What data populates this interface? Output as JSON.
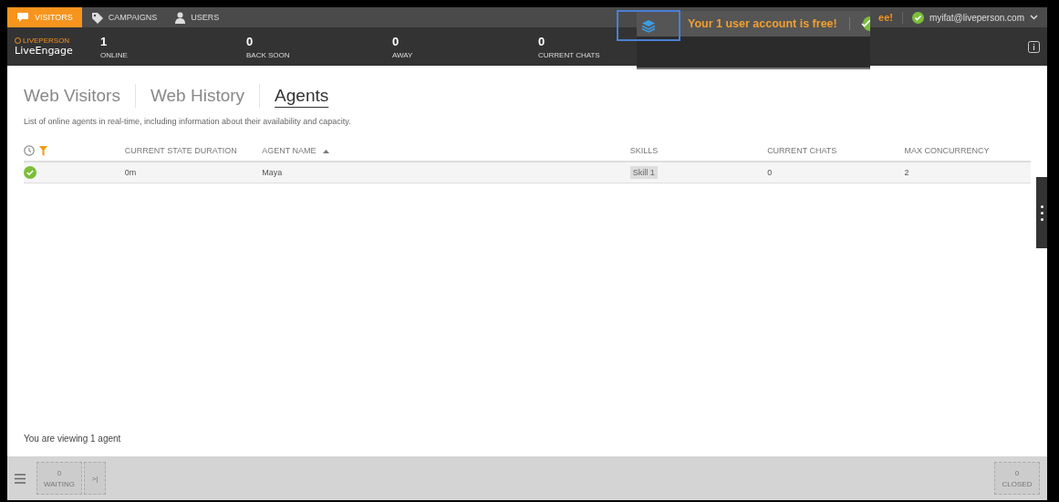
{
  "nav_tabs": [
    {
      "label": "VISITORS",
      "kind": "chat",
      "selected": true
    },
    {
      "label": "CAMPAIGNS",
      "kind": "tag",
      "selected": false
    },
    {
      "label": "USERS",
      "kind": "user",
      "selected": false
    }
  ],
  "brand": {
    "small": "LIVEPERSON",
    "name": "LiveEngage"
  },
  "stats": [
    {
      "value": "1",
      "label": "ONLINE"
    },
    {
      "value": "0",
      "label": "BACK SOON"
    },
    {
      "value": "0",
      "label": "AWAY"
    },
    {
      "value": "0",
      "label": "CURRENT CHATS"
    }
  ],
  "notice_tail": "ee!",
  "user": {
    "email": "myifat@liveperson.com",
    "online": true
  },
  "popup": {
    "text": "Your 1 user account is free!"
  },
  "view_tabs": [
    {
      "label": "Web Visitors",
      "selected": false
    },
    {
      "label": "Web History",
      "selected": false
    },
    {
      "label": "Agents",
      "selected": true
    }
  ],
  "description": "List of online agents in real-time, including information about their availability and capacity.",
  "table": {
    "columns": [
      {
        "label": "CURRENT STATE DURATION",
        "sorted": false
      },
      {
        "label": "AGENT NAME",
        "sorted": true
      },
      {
        "label": "SKILLS",
        "sorted": false
      },
      {
        "label": "CURRENT CHATS",
        "sorted": false
      },
      {
        "label": "MAX CONCURRENCY",
        "sorted": false
      }
    ],
    "rows": [
      {
        "available": true,
        "duration": "0m",
        "name": "Maya",
        "skill": "Skill 1",
        "chats": "0",
        "max": "2"
      }
    ]
  },
  "status": "You are viewing 1 agent",
  "footer": {
    "waiting": {
      "value": "0",
      "label": "WAITING"
    },
    "next": ">|",
    "closed": {
      "value": "0",
      "label": "CLOSED"
    }
  }
}
